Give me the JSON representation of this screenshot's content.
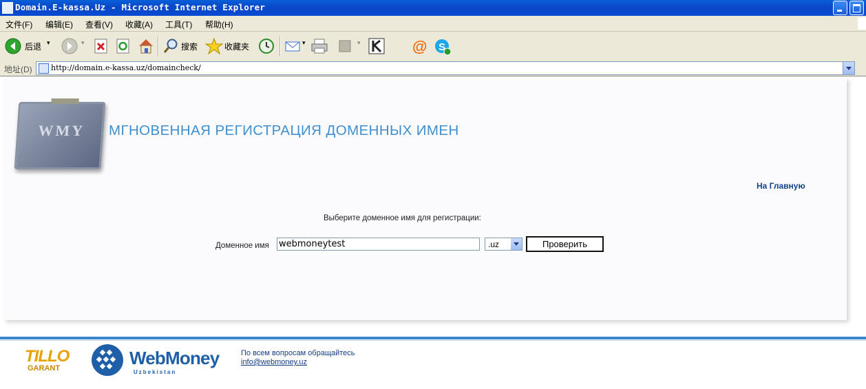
{
  "window": {
    "title": "Domain.E-kassa.Uz - Microsoft Internet Explorer"
  },
  "menu": [
    {
      "label": "文件(F)"
    },
    {
      "label": "编辑(E)"
    },
    {
      "label": "查看(V)"
    },
    {
      "label": "收藏(A)"
    },
    {
      "label": "工具(T)"
    },
    {
      "label": "帮助(H)"
    }
  ],
  "toolbar": {
    "back_label": "后退",
    "search_label": "搜索",
    "favorites_label": "收藏夹"
  },
  "address": {
    "label": "地址(D)",
    "url": "http://domain.e-kassa.uz/domaincheck/"
  },
  "page": {
    "logo_text": "WMY",
    "heading": "МГНОВЕННАЯ РЕГИСТРАЦИЯ ДОМЕННЫХ ИМЕН",
    "home_link": "На Главную",
    "choose_prompt": "Выберите доменное имя для регистрации:",
    "domain_label": "Доменное имя",
    "domain_value": "webmoneytest",
    "zone_value": ".uz",
    "check_button": "Проверить"
  },
  "footer": {
    "tillo_top": "TILLO",
    "tillo_bottom": "GARANT",
    "webmoney_name": "WebMoney",
    "webmoney_sub": "Uzbekistan",
    "contact_text": "По всем вопросам обращайтесь",
    "contact_email": "info@webmoney.uz"
  },
  "colors": {
    "title_bar": "#0847c7",
    "heading": "#3f8fcf",
    "link": "#12418d",
    "footer_line": "#3a86cf"
  }
}
